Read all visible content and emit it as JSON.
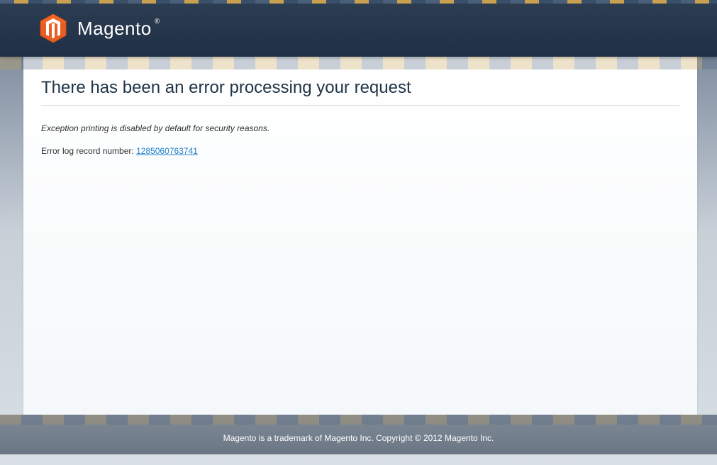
{
  "header": {
    "brand_name": "Magento",
    "brand_symbol": "®"
  },
  "main": {
    "title": "There has been an error processing your request",
    "exception_message": "Exception printing is disabled by default for security reasons.",
    "error_log_label": "Error log record number: ",
    "error_log_number": "1285060763741"
  },
  "footer": {
    "trademark_text": "Magento is a trademark of Magento Inc. Copyright © 2012 Magento Inc."
  }
}
